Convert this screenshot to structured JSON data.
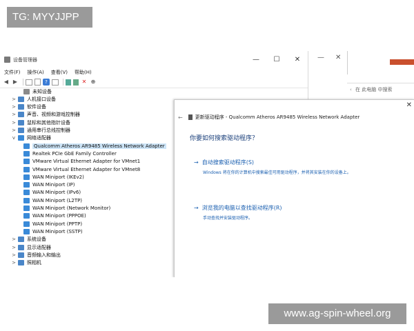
{
  "overlay": {
    "tg_label": "TG: MYYJJPP",
    "watermark": "www.ag-spin-wheel.org"
  },
  "device_manager": {
    "title": "设备管理器",
    "window_controls": {
      "minimize": "—",
      "maximize": "☐",
      "close": "✕"
    },
    "menu": [
      "文件(F)",
      "操作(A)",
      "查看(V)",
      "帮助(H)"
    ],
    "tree": [
      {
        "label": "未知设备",
        "level": 2,
        "expander": "",
        "icon": "unknown-device-icon"
      },
      {
        "label": "人机接口设备",
        "level": 1,
        "expander": ">",
        "icon": "hid-icon"
      },
      {
        "label": "软件设备",
        "level": 1,
        "expander": ">",
        "icon": "software-device-icon"
      },
      {
        "label": "声音、视频和游戏控制器",
        "level": 1,
        "expander": ">",
        "icon": "sound-icon"
      },
      {
        "label": "鼠标和其他指针设备",
        "level": 1,
        "expander": ">",
        "icon": "mouse-icon"
      },
      {
        "label": "通用串行总线控制器",
        "level": 1,
        "expander": ">",
        "icon": "usb-icon"
      },
      {
        "label": "网络适配器",
        "level": 1,
        "expander": "v",
        "icon": "network-adapter-icon"
      },
      {
        "label": "Qualcomm Atheros AR9485 Wireless Network Adapter",
        "level": 2,
        "expander": "",
        "icon": "network-adapter-icon",
        "selected": true
      },
      {
        "label": "Realtek PCIe GbE Family Controller",
        "level": 2,
        "expander": "",
        "icon": "network-adapter-icon"
      },
      {
        "label": "VMware Virtual Ethernet Adapter for VMnet1",
        "level": 2,
        "expander": "",
        "icon": "network-adapter-icon"
      },
      {
        "label": "VMware Virtual Ethernet Adapter for VMnet8",
        "level": 2,
        "expander": "",
        "icon": "network-adapter-icon"
      },
      {
        "label": "WAN Miniport (IKEv2)",
        "level": 2,
        "expander": "",
        "icon": "network-adapter-icon"
      },
      {
        "label": "WAN Miniport (IP)",
        "level": 2,
        "expander": "",
        "icon": "network-adapter-icon"
      },
      {
        "label": "WAN Miniport (IPv6)",
        "level": 2,
        "expander": "",
        "icon": "network-adapter-icon"
      },
      {
        "label": "WAN Miniport (L2TP)",
        "level": 2,
        "expander": "",
        "icon": "network-adapter-icon"
      },
      {
        "label": "WAN Miniport (Network Monitor)",
        "level": 2,
        "expander": "",
        "icon": "network-adapter-icon"
      },
      {
        "label": "WAN Miniport (PPPOE)",
        "level": 2,
        "expander": "",
        "icon": "network-adapter-icon"
      },
      {
        "label": "WAN Miniport (PPTP)",
        "level": 2,
        "expander": "",
        "icon": "network-adapter-icon"
      },
      {
        "label": "WAN Miniport (SSTP)",
        "level": 2,
        "expander": "",
        "icon": "network-adapter-icon"
      },
      {
        "label": "系统设备",
        "level": 1,
        "expander": ">",
        "icon": "system-device-icon"
      },
      {
        "label": "显示适配器",
        "level": 1,
        "expander": ">",
        "icon": "display-adapter-icon"
      },
      {
        "label": "音频输入和输出",
        "level": 1,
        "expander": ">",
        "icon": "audio-icon"
      },
      {
        "label": "照相机",
        "level": 1,
        "expander": ">",
        "icon": "camera-icon"
      }
    ]
  },
  "update_dialog": {
    "close": "✕",
    "back": "←",
    "header": "更新驱动程序 - Qualcomm Atheros AR9485 Wireless Network Adapter",
    "question": "你要如何搜索驱动程序？",
    "arrow": "→",
    "option_auto": {
      "title": "自动搜索驱动程序(S)",
      "desc": "Windows 将在你的计算机中搜索最佳可用驱动程序，并将其安装在你的设备上。"
    },
    "option_browse": {
      "title": "浏览我的电脑以查找驱动程序(R)",
      "desc": "手动查找并安装驱动程序。"
    }
  },
  "background_window": {
    "minimize": "—",
    "close": "✕",
    "search_placeholder": "在 此电脑 中搜索"
  }
}
